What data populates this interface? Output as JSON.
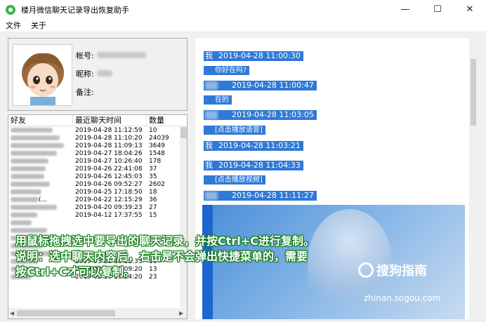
{
  "window": {
    "title": "楼月微信聊天记录导出恢复助手",
    "minimize": "—",
    "maximize": "☐",
    "close": "✕"
  },
  "menu": [
    "文件",
    "关于"
  ],
  "user": {
    "account_label": "帐号:",
    "nickname_label": "昵称:",
    "note_label": "备注:"
  },
  "friends": {
    "headers": [
      "好友",
      "最近聊天时间",
      "数量"
    ],
    "rows": [
      {
        "name": "",
        "time": "2019-04-28 11:12:59",
        "count": "10"
      },
      {
        "name": "",
        "time": "2019-04-28 11:10:20",
        "count": "24039"
      },
      {
        "name": "",
        "time": "2019-04-28 11:09:13",
        "count": "3649"
      },
      {
        "name": "",
        "time": "2019-04-27 18:04:26",
        "count": "1548"
      },
      {
        "name": "",
        "time": "2019-04-27 10:26:40",
        "count": "178"
      },
      {
        "name": "",
        "time": "2019-04-26 22:41:08",
        "count": "37"
      },
      {
        "name": "",
        "time": "2019-04-26 12:45:03",
        "count": "35"
      },
      {
        "name": "",
        "time": "2019-04-26 09:52:27",
        "count": "2602"
      },
      {
        "name": "",
        "time": "2019-04-25 17:18:50",
        "count": "18"
      },
      {
        "name": "(...",
        "time": "2019-04-22 12:15:29",
        "count": "36"
      },
      {
        "name": "",
        "time": "2019-04-20 09:39:23",
        "count": "27"
      },
      {
        "name": "",
        "time": "2019-04-12 17:37:55",
        "count": "15"
      },
      {
        "name": "",
        "time": "",
        "count": ""
      },
      {
        "name": "",
        "time": "",
        "count": ""
      },
      {
        "name": "",
        "time": "",
        "count": ""
      },
      {
        "name": "",
        "time": "",
        "count": ""
      },
      {
        "name": "",
        "time": "",
        "count": ""
      },
      {
        "name": "",
        "time": "2019-03-22 13:22:35",
        "count": "11"
      },
      {
        "name": "",
        "time": "2019-02-20 15:09:20",
        "count": "13"
      },
      {
        "name": "",
        "time": "2019-02-19 15:24:20",
        "count": "23"
      }
    ]
  },
  "chat": {
    "messages": [
      {
        "sender": "我",
        "time": "2019-04-28 11:00:30",
        "text": "你好在吗?"
      },
      {
        "sender": "",
        "time": "2019-04-28 11:00:47",
        "text": "在的"
      },
      {
        "sender": "",
        "time": "2019-04-28 11:03:05",
        "text": "[点击播放语音]"
      },
      {
        "sender": "我",
        "time": "2019-04-28 11:03:21",
        "text": ""
      },
      {
        "sender": "我",
        "time": "2019-04-28 11:04:33",
        "text": "[点击播放视频]"
      },
      {
        "sender": "",
        "time": "2019-04-28 11:11:27",
        "text": ""
      }
    ]
  },
  "overlay": {
    "line1": "用鼠标拖拽选中要导出的聊天记录，并按Ctrl+C进行复制。",
    "line2": "说明：选中聊天内容后，右击是不会弹出快捷菜单的，需要",
    "line3": "按Ctrl+C才可以复制。"
  },
  "watermark": {
    "brand": "搜狗指南",
    "url": "zhinan.sogou.com"
  },
  "colors": {
    "selection": "#3079d6",
    "overlay_stroke": "#0c7a12"
  }
}
